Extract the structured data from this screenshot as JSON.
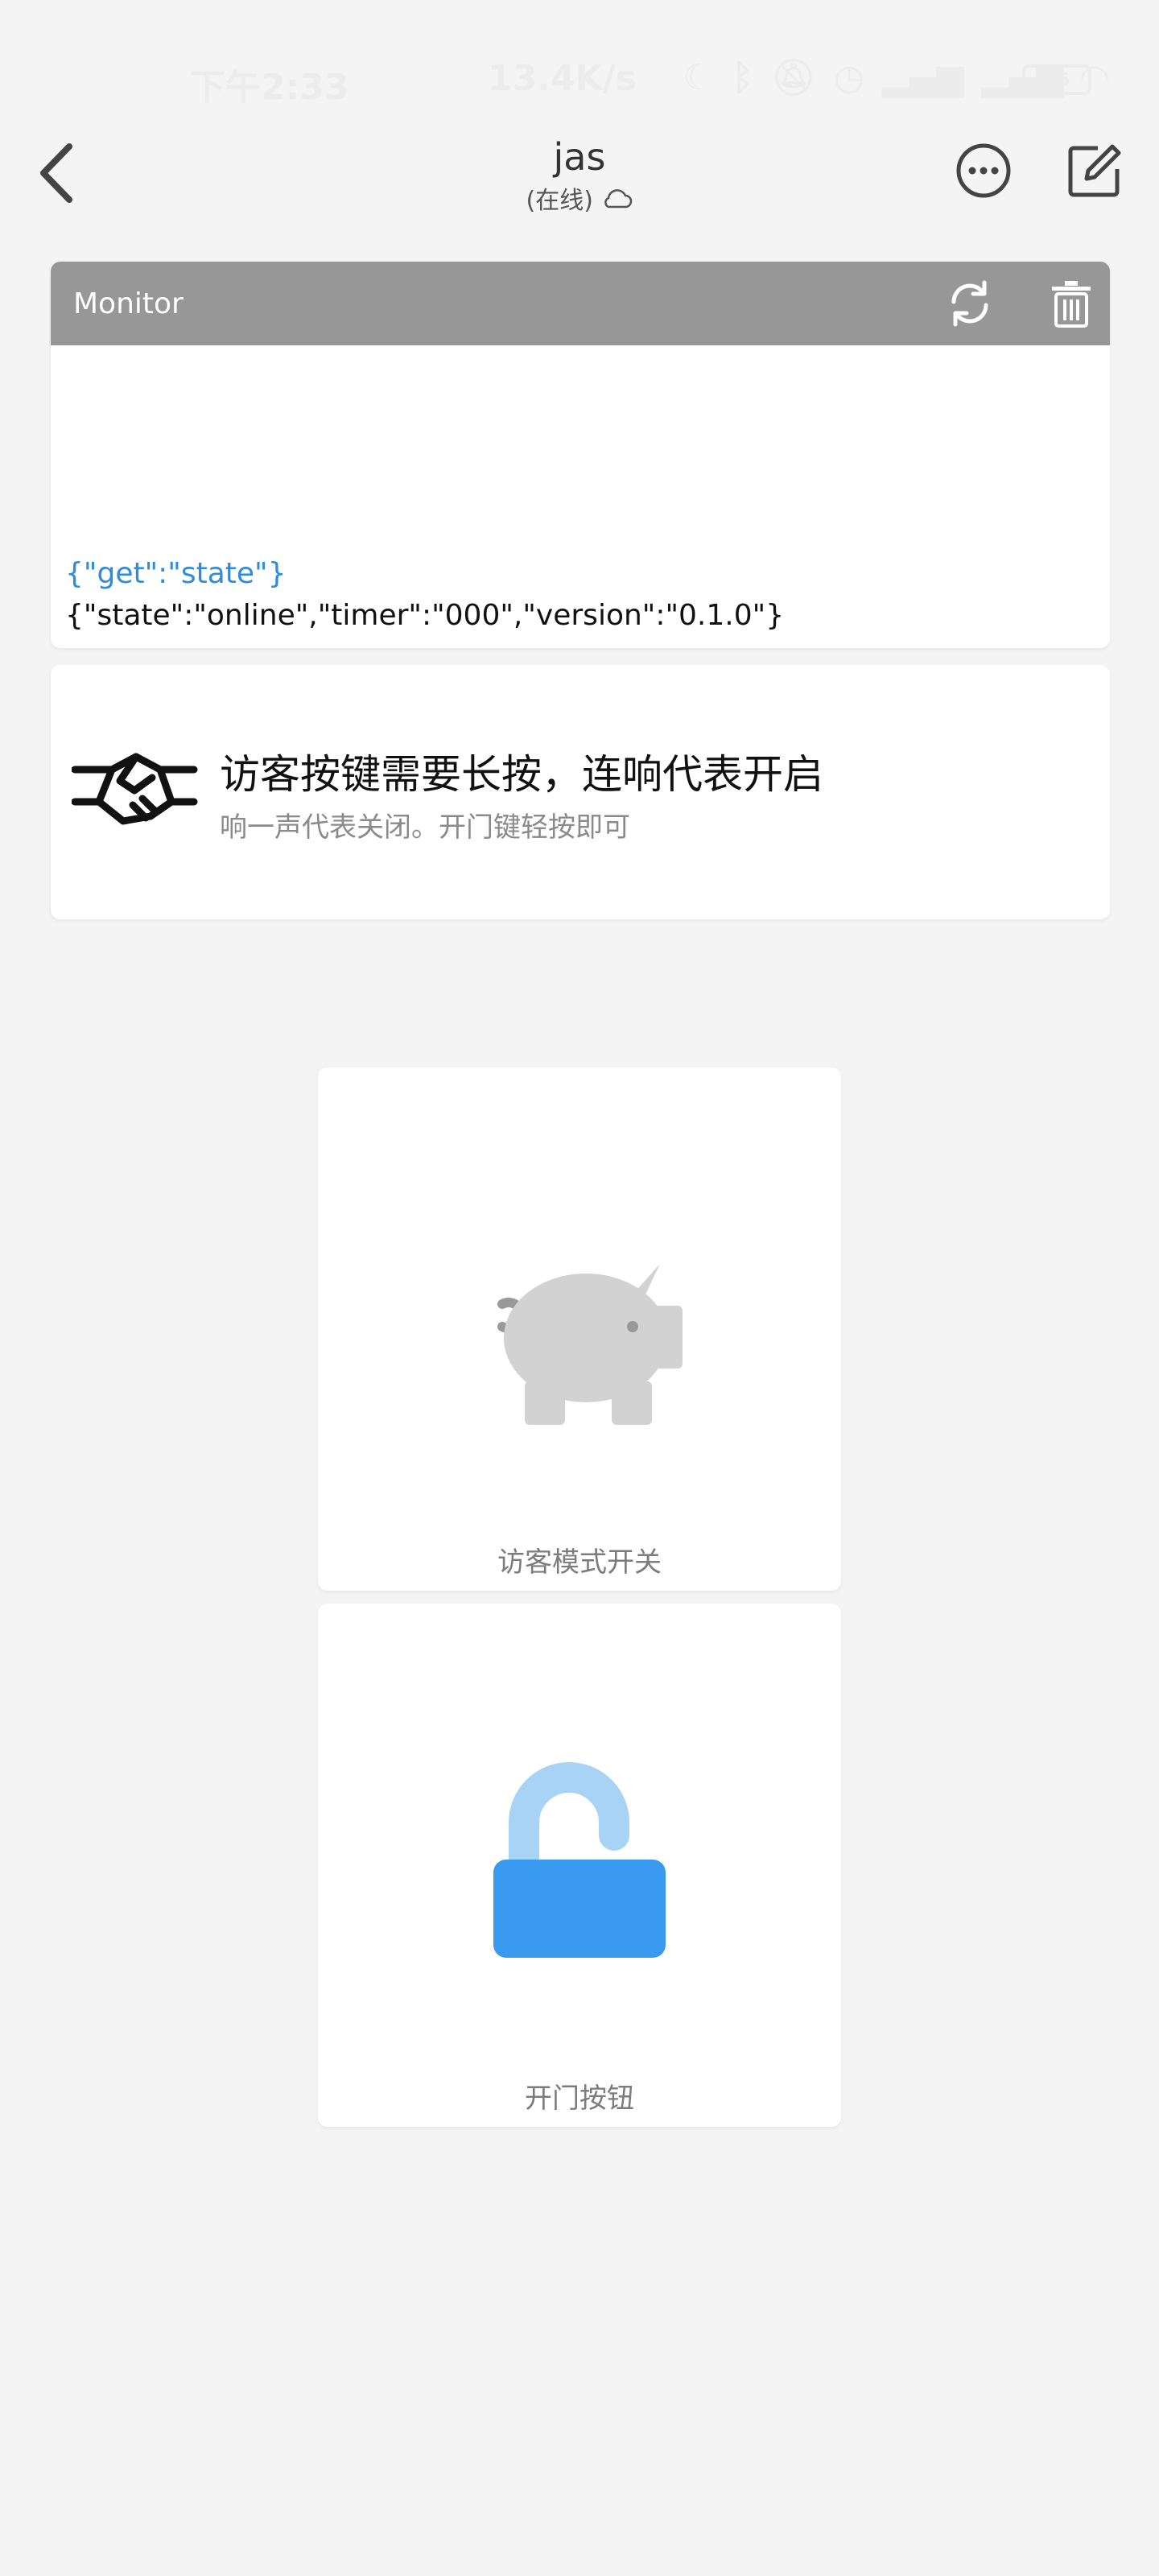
{
  "status_bar": {
    "time": "下午2:33",
    "net_speed": "13.4K/s",
    "battery": "75",
    "icons": [
      "moon-icon",
      "bluetooth-icon",
      "mute-icon",
      "alarm-icon",
      "signal-icon",
      "signal-icon",
      "wifi-icon",
      "battery-icon"
    ]
  },
  "header": {
    "title": "jas",
    "subtitle": "(在线)",
    "icons": [
      "back-icon",
      "cloud-icon",
      "more-icon",
      "edit-icon"
    ]
  },
  "monitor": {
    "title": "Monitor",
    "sent": "{\"get\":\"state\"}",
    "received": "{\"state\":\"online\",\"timer\":\"000\",\"version\":\"0.1.0\"}",
    "icons": [
      "refresh-icon",
      "trash-icon"
    ],
    "colors": {
      "bar": "#979797",
      "sent_text": "#2f8cd8"
    }
  },
  "notice": {
    "title": "访客按键需要长按，连响代表开启",
    "description": "响一声代表关闭。开门键轻按即可",
    "icon": "handshake-icon"
  },
  "tiles": [
    {
      "label": "访客模式开关",
      "icon": "piggy-bank-icon",
      "state": "off"
    },
    {
      "label": "开门按钮",
      "icon": "unlock-icon",
      "color": "#3a9af0"
    }
  ]
}
